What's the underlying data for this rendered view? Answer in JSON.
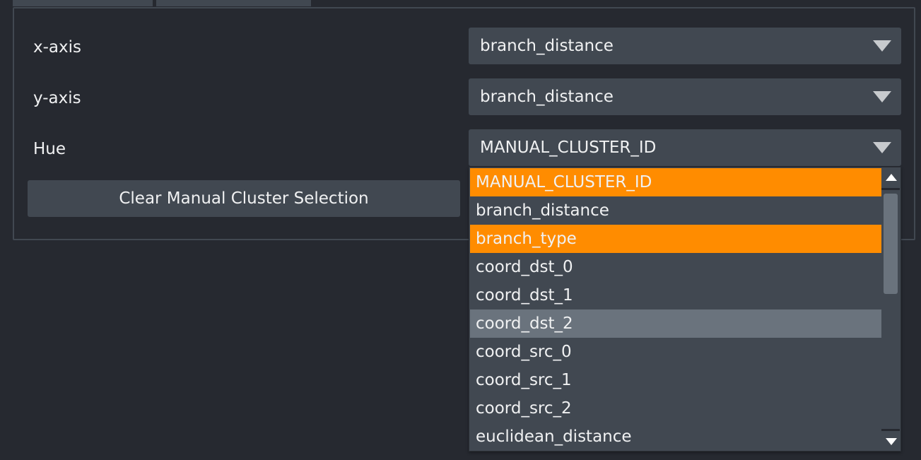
{
  "controls": {
    "x_axis": {
      "label": "x-axis",
      "value": "branch_distance"
    },
    "y_axis": {
      "label": "y-axis",
      "value": "branch_distance"
    },
    "hue": {
      "label": "Hue",
      "value": "MANUAL_CLUSTER_ID"
    }
  },
  "clear_button": {
    "label": "Clear Manual Cluster Selection"
  },
  "hue_dropdown": {
    "options": [
      "MANUAL_CLUSTER_ID",
      "branch_distance",
      "branch_type",
      "coord_dst_0",
      "coord_dst_1",
      "coord_dst_2",
      "coord_src_0",
      "coord_src_1",
      "coord_src_2",
      "euclidean_distance"
    ],
    "highlighted": [
      "MANUAL_CLUSTER_ID",
      "branch_type"
    ],
    "hovered": "coord_dst_2"
  },
  "colors": {
    "background": "#262930",
    "control": "#414851",
    "highlight": "#ff8c00",
    "hover": "#6a737d",
    "text": "#f0f1f2"
  },
  "icons": {
    "combo_arrow": "chevron-down-icon",
    "scroll_up": "arrow-up-icon",
    "scroll_down": "arrow-down-icon"
  }
}
